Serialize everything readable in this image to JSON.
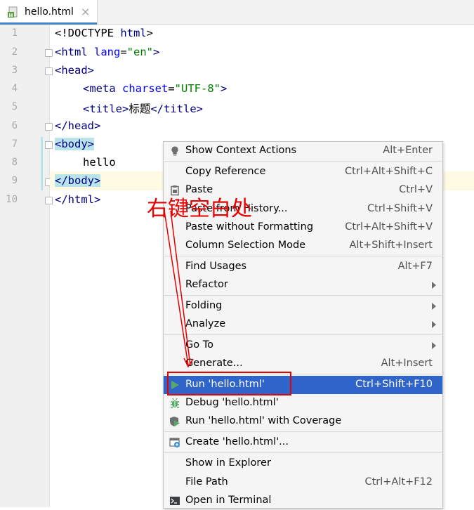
{
  "tab": {
    "filename": "hello.html",
    "close": "×",
    "icon": "html-file-icon"
  },
  "editor": {
    "line_numbers": [
      "1",
      "2",
      "3",
      "4",
      "5",
      "6",
      "7",
      "8",
      "9",
      "10"
    ],
    "lines": {
      "l1": {
        "t1": "<!DOCTYPE ",
        "t2": "html",
        "t3": ">"
      },
      "l2": {
        "t1": "<html ",
        "t2": "lang",
        "t3": "=",
        "t4": "\"en\"",
        "t5": ">"
      },
      "l3": {
        "t1": "<head>"
      },
      "l4": {
        "t1": "<meta ",
        "t2": "charset",
        "t3": "=",
        "t4": "\"UTF-8\"",
        "t5": ">"
      },
      "l5": {
        "t1": "<title>",
        "t2": "标题",
        "t3": "</title>"
      },
      "l6": {
        "t1": "</head>"
      },
      "l7": {
        "t1": "<body>"
      },
      "l8": {
        "t1": "hello"
      },
      "l9": {
        "t1": "</body>"
      },
      "l10": {
        "t1": "</html>"
      }
    }
  },
  "context_menu": {
    "items": [
      {
        "label": "Show Context Actions",
        "shortcut": "Alt+Enter",
        "icon": "bulb-icon"
      },
      {
        "label": "Copy Reference",
        "shortcut": "Ctrl+Alt+Shift+C"
      },
      {
        "label": "Paste",
        "shortcut": "Ctrl+V",
        "icon": "clipboard-icon"
      },
      {
        "label": "Paste from History...",
        "shortcut": "Ctrl+Shift+V"
      },
      {
        "label": "Paste without Formatting",
        "shortcut": "Ctrl+Alt+Shift+V"
      },
      {
        "label": "Column Selection Mode",
        "shortcut": "Alt+Shift+Insert"
      },
      {
        "label": "Find Usages",
        "shortcut": "Alt+F7"
      },
      {
        "label": "Refactor",
        "shortcut": ""
      },
      {
        "label": "Folding",
        "shortcut": ""
      },
      {
        "label": "Analyze",
        "shortcut": ""
      },
      {
        "label": "Go To",
        "shortcut": ""
      },
      {
        "label": "Generate...",
        "shortcut": "Alt+Insert"
      },
      {
        "label": "Run 'hello.html'",
        "shortcut": "Ctrl+Shift+F10",
        "icon": "run-icon",
        "selected": true
      },
      {
        "label": "Debug 'hello.html'",
        "shortcut": "",
        "icon": "debug-icon"
      },
      {
        "label": "Run 'hello.html' with Coverage",
        "shortcut": "",
        "icon": "coverage-icon"
      },
      {
        "label": "Create 'hello.html'...",
        "shortcut": "",
        "icon": "create-config-icon"
      },
      {
        "label": "Show in Explorer",
        "shortcut": ""
      },
      {
        "label": "File Path",
        "shortcut": "Ctrl+Alt+F12"
      },
      {
        "label": "Open in Terminal",
        "shortcut": "",
        "icon": "terminal-icon"
      }
    ]
  },
  "annotation": {
    "text": "右键空白处",
    "color": "#e60000"
  },
  "colors": {
    "selection": "#2f65ca",
    "tag": "#000080",
    "attr": "#0000ff",
    "string": "#008000",
    "highlight": "#b9e4ec"
  }
}
